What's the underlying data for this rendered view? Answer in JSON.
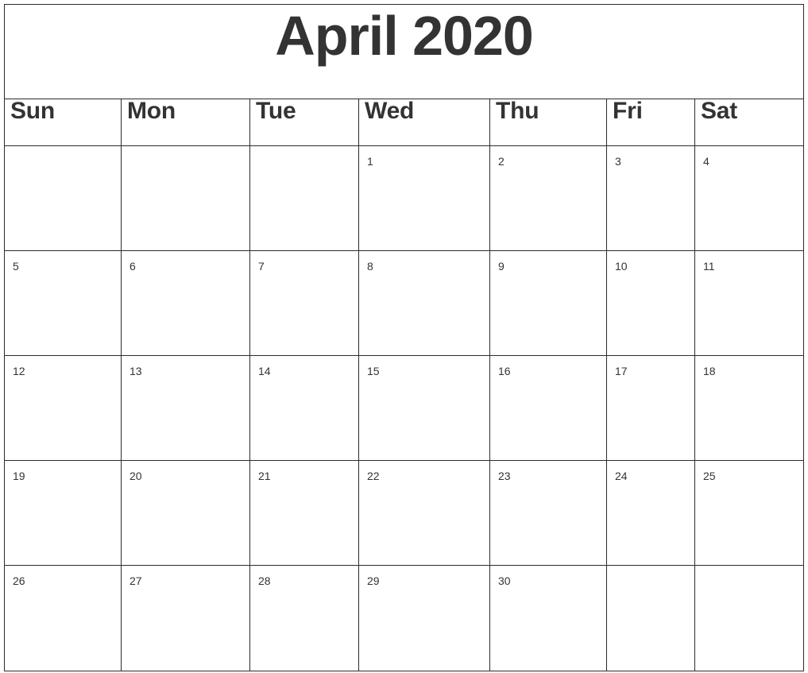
{
  "calendar": {
    "title": "April 2020",
    "month": "April",
    "year": "2020",
    "text_color": "#333333",
    "border_color": "#2b2b2b",
    "background_color": "#ffffff",
    "weekdays": [
      {
        "short": "Sun"
      },
      {
        "short": "Mon"
      },
      {
        "short": "Tue"
      },
      {
        "short": "Wed"
      },
      {
        "short": "Thu"
      },
      {
        "short": "Fri"
      },
      {
        "short": "Sat"
      }
    ],
    "weeks": [
      {
        "days": [
          "",
          "",
          "",
          "1",
          "2",
          "3",
          "4"
        ]
      },
      {
        "days": [
          "5",
          "6",
          "7",
          "8",
          "9",
          "10",
          "11"
        ]
      },
      {
        "days": [
          "12",
          "13",
          "14",
          "15",
          "16",
          "17",
          "18"
        ]
      },
      {
        "days": [
          "19",
          "20",
          "21",
          "22",
          "23",
          "24",
          "25"
        ]
      },
      {
        "days": [
          "26",
          "27",
          "28",
          "29",
          "30",
          "",
          ""
        ]
      }
    ]
  }
}
